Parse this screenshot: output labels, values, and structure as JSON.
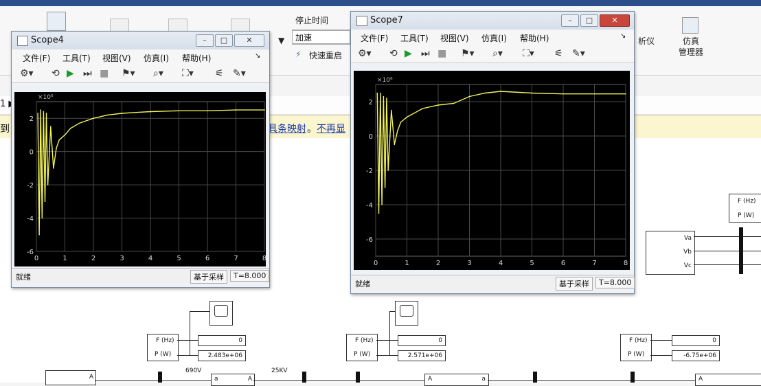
{
  "ribbon": {
    "stop_time_label": "停止时间",
    "solver_mode": "加速",
    "fast_restart": "快速重启",
    "analyzer_label": "析仪",
    "sim_manager_line1": "仿真",
    "sim_manager_line2": "管理器"
  },
  "infobar": {
    "prefix": "到",
    "link1": "具条映射",
    "sep": "。",
    "link2": "不再显"
  },
  "scope4": {
    "title": "Scope4",
    "menus": [
      "文件(F)",
      "工具(T)",
      "视图(V)",
      "仿真(I)",
      "帮助(H)"
    ],
    "exponent": "×10⁶",
    "y_ticks": [
      "2",
      "0",
      "-2",
      "-4",
      "-6"
    ],
    "x_ticks": [
      "0",
      "1",
      "2",
      "3",
      "4",
      "5",
      "6",
      "7",
      "8"
    ],
    "status_ready": "就绪",
    "status_sample": "基于采样",
    "status_time": "T=8.000"
  },
  "scope7": {
    "title": "Scope7",
    "menus": [
      "文件(F)",
      "工具(T)",
      "视图(V)",
      "仿真(I)",
      "帮助(H)"
    ],
    "exponent": "×10⁶",
    "y_ticks": [
      "2",
      "0",
      "-2",
      "-4",
      "-6"
    ],
    "x_ticks": [
      "0",
      "1",
      "2",
      "3",
      "4",
      "5",
      "6",
      "7",
      "8"
    ],
    "status_ready": "就绪",
    "status_sample": "基于采样",
    "status_time": "T=8.000"
  },
  "model": {
    "voltage_label_1": "690V",
    "voltage_label_2": "25KV",
    "port_a": "A",
    "port_a_lower": "a",
    "meas1": {
      "f_label": "F (Hz)",
      "p_label": "P (W)",
      "f_value": "0",
      "p_value": "2.483e+06"
    },
    "meas2": {
      "f_label": "F (Hz)",
      "p_label": "P (W)",
      "f_value": "0",
      "p_value": "2.571e+06"
    },
    "meas3": {
      "f_label": "F (Hz)",
      "p_label": "P (W)",
      "f_value": "0",
      "p_value": "-6.75e+06"
    },
    "meas4": {
      "f_label": "F (Hz)",
      "p_label": "P (W)"
    },
    "vabc": {
      "va": "Va",
      "vb": "Vb",
      "vc": "Vc"
    }
  },
  "chart_data": [
    {
      "type": "line",
      "title": "Scope4",
      "xlim": [
        0,
        8
      ],
      "ylim": [
        -6,
        3
      ],
      "y_multiplier": "1e6",
      "grid": true,
      "series": [
        {
          "color": "#f2f25a",
          "x": [
            0.05,
            0.1,
            0.15,
            0.2,
            0.25,
            0.3,
            0.35,
            0.4,
            0.5,
            0.6,
            0.7,
            0.8,
            1,
            1.2,
            1.5,
            2,
            2.5,
            3,
            3.5,
            4,
            5,
            6,
            7,
            8
          ],
          "y": [
            2.3,
            -5,
            2.5,
            -4,
            2.4,
            -3,
            2.3,
            -2,
            1.5,
            -1,
            0.2,
            0.7,
            1.0,
            1.4,
            1.7,
            2.0,
            2.2,
            2.3,
            2.35,
            2.4,
            2.45,
            2.45,
            2.5,
            2.5
          ]
        }
      ]
    },
    {
      "type": "line",
      "title": "Scope7",
      "xlim": [
        0,
        8
      ],
      "ylim": [
        -7,
        3
      ],
      "y_multiplier": "1e6",
      "grid": true,
      "series": [
        {
          "color": "#f2f25a",
          "x": [
            0.05,
            0.1,
            0.15,
            0.2,
            0.25,
            0.3,
            0.35,
            0.4,
            0.5,
            0.6,
            0.7,
            0.8,
            1,
            1.5,
            2,
            2.5,
            3,
            3.5,
            4,
            5,
            6,
            7,
            8
          ],
          "y": [
            2.5,
            -4.5,
            2.5,
            -4,
            2.3,
            -3,
            2.2,
            -2,
            1.5,
            -0.5,
            0.3,
            0.8,
            1.1,
            1.6,
            1.8,
            1.9,
            2.3,
            2.5,
            2.6,
            2.5,
            2.45,
            2.45,
            2.45
          ]
        }
      ]
    }
  ]
}
